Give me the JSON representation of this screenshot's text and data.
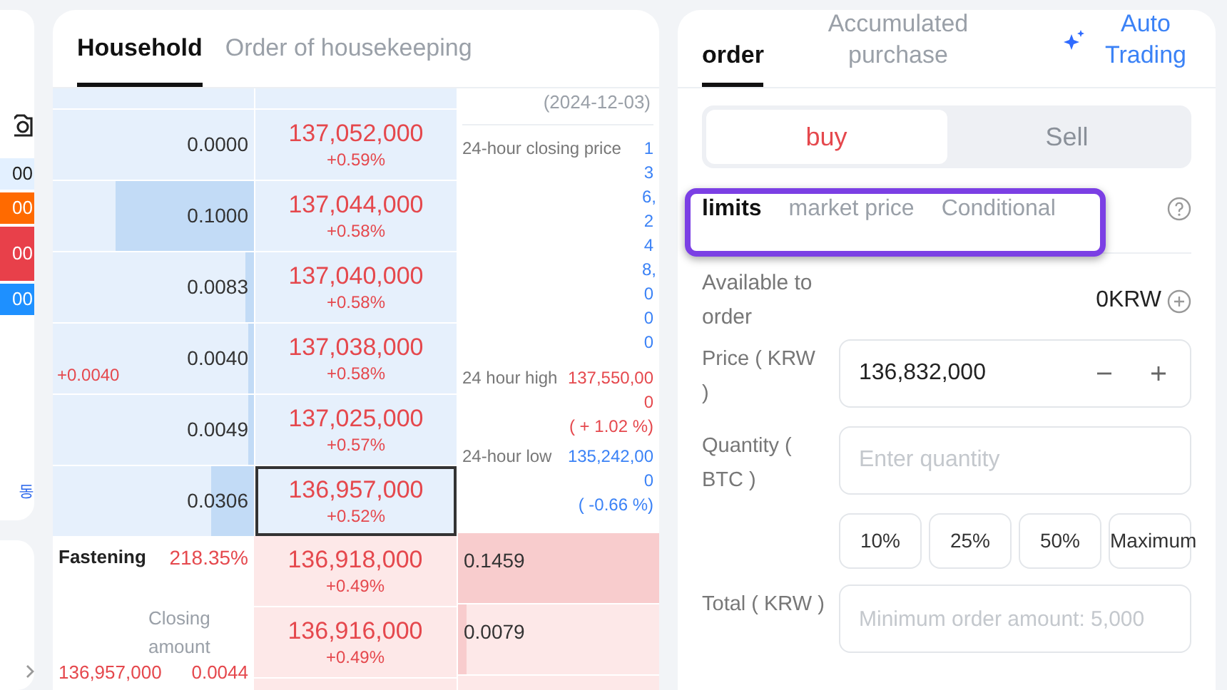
{
  "side_strip": {
    "badges": [
      {
        "text": "00",
        "color": "#e3f0ff"
      },
      {
        "text": "00",
        "color": "#ff6a00"
      },
      {
        "text": "00",
        "color": "#e8404a"
      },
      {
        "text": "00",
        "color": "#1e90ff"
      }
    ],
    "vertical_label": "동"
  },
  "orderbook": {
    "tabs": [
      {
        "label": "Household",
        "selected": true
      },
      {
        "label": "Order of housekeeping",
        "selected": false
      }
    ],
    "asks": [
      {
        "quantity": "0.0000",
        "price": "137,052,000",
        "change": "+0.59%",
        "selected": false
      },
      {
        "quantity": "0.1000",
        "level": 0.69,
        "price": "137,044,000",
        "change": "+0.58%",
        "selected": false
      },
      {
        "quantity": "0.0083",
        "level": 0.04,
        "price": "137,040,000",
        "change": "+0.58%",
        "selected": false
      },
      {
        "quantity": "0.0040",
        "level": 0.03,
        "price": "137,038,000",
        "change": "+0.58%",
        "delta": "+0.0040",
        "selected": false
      },
      {
        "quantity": "0.0049",
        "level": 0.03,
        "price": "137,025,000",
        "change": "+0.57%",
        "selected": false
      },
      {
        "quantity": "0.0306",
        "level": 0.21,
        "price": "136,957,000",
        "change": "+0.52%",
        "selected": true
      }
    ],
    "bids": [
      {
        "quantity": "0.1459",
        "level": 1,
        "price": "136,918,000",
        "change": "+0.49%"
      },
      {
        "quantity": "0.0079",
        "level": 0.04,
        "price": "136,916,000",
        "change": "+0.49%"
      }
    ],
    "stats": {
      "date": "(2024-12-03)",
      "items": [
        {
          "label": "24-hour closing price",
          "value": "136,248,000",
          "kind": "narrow",
          "color": "#3b82f6"
        },
        {
          "label": "24 hour high",
          "value": "137,550,000",
          "change": "( + 1.02 %)",
          "kind": "wide",
          "color": "#e5484d"
        },
        {
          "label": "24-hour low",
          "value": "135,242,000",
          "change": "( -0.66 %)",
          "kind": "wide",
          "color": "#3b82f6"
        }
      ]
    },
    "fill_info": {
      "label": "Fastening",
      "rate": "218.35%",
      "amount_label": "Closing amount",
      "price": "136,957,000",
      "quantity": "0.0044"
    }
  },
  "order_panel": {
    "tabs": [
      {
        "label": "order",
        "selected": true,
        "kind": "plain"
      },
      {
        "label": "Accumulated purchase",
        "selected": false,
        "kind": "plain"
      },
      {
        "label": "Auto Trading",
        "selected": false,
        "kind": "auto"
      }
    ],
    "sides": [
      {
        "label": "buy",
        "selected": true
      },
      {
        "label": "Sell",
        "selected": false
      }
    ],
    "order_types": [
      {
        "label": "limits",
        "selected": true
      },
      {
        "label": "market price",
        "selected": false
      },
      {
        "label": "Conditional",
        "selected": false
      }
    ],
    "available": {
      "label": "Available to order",
      "value": "0KRW"
    },
    "price": {
      "label": "Price ( KRW )",
      "value": "136,832,000"
    },
    "quantity": {
      "label": "Quantity ( BTC )",
      "placeholder": "Enter quantity"
    },
    "percent_buttons": [
      "10%",
      "25%",
      "50%",
      "Maximum"
    ],
    "total": {
      "label": "Total ( KRW )",
      "placeholder": "Minimum order amount: 5,000"
    }
  }
}
